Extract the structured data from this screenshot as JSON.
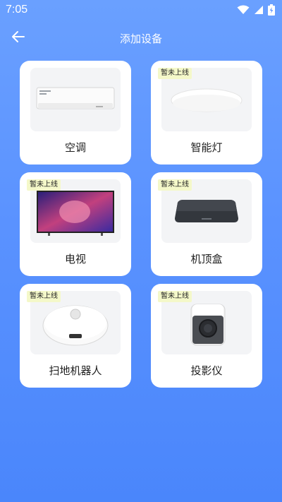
{
  "status_bar": {
    "time": "7:05",
    "icons": [
      "wifi-icon",
      "cell-signal-icon",
      "battery-charging-icon"
    ]
  },
  "header": {
    "title": "添加设备",
    "back_icon": "arrow-left-icon"
  },
  "badge_text": "暂未上线",
  "devices": [
    {
      "id": "air-conditioner",
      "label": "空调",
      "online": true,
      "badge": "",
      "image": "air-conditioner-image"
    },
    {
      "id": "smart-light",
      "label": "智能灯",
      "online": false,
      "badge": "暂未上线",
      "image": "ceiling-light-image"
    },
    {
      "id": "tv",
      "label": "电视",
      "online": false,
      "badge": "暂未上线",
      "image": "tv-image"
    },
    {
      "id": "set-top-box",
      "label": "机顶盒",
      "online": false,
      "badge": "暂未上线",
      "image": "set-top-box-image"
    },
    {
      "id": "robot-vacuum",
      "label": "扫地机器人",
      "online": false,
      "badge": "暂未上线",
      "image": "robot-vacuum-image"
    },
    {
      "id": "projector",
      "label": "投影仪",
      "online": false,
      "badge": "暂未上线",
      "image": "projector-image"
    }
  ],
  "colors": {
    "bg_top": "#6aa0ff",
    "bg_bottom": "#4a86fb",
    "badge_bg": "#f4f8c9"
  }
}
